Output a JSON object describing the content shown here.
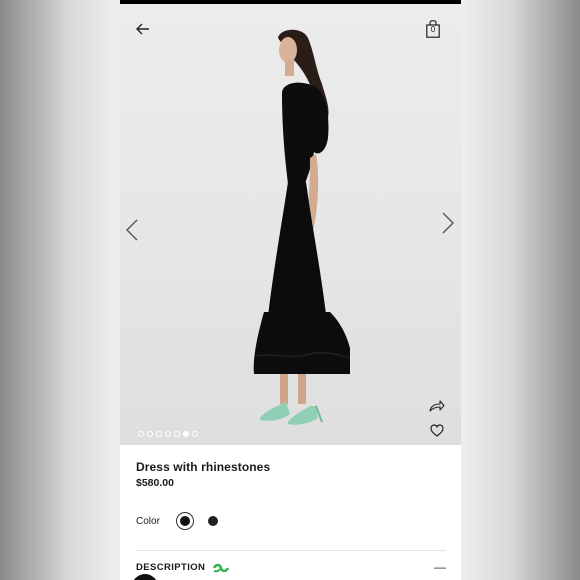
{
  "header": {
    "back_icon": "back-arrow-icon",
    "bag_icon": "shopping-bag-icon",
    "bag_count": "0"
  },
  "gallery": {
    "prev_icon": "chevron-left-icon",
    "next_icon": "chevron-right-icon",
    "share_icon": "share-icon",
    "wishlist_icon": "heart-icon",
    "total_images": 7,
    "active_index": 5
  },
  "product": {
    "title": "Dress with rhinestones",
    "price": "$580.00"
  },
  "color": {
    "label": "Color",
    "options": [
      {
        "name": "black",
        "hex": "#111111",
        "selected": true
      },
      {
        "name": "dark",
        "hex": "#222222",
        "selected": false
      }
    ]
  },
  "description": {
    "label": "DESCRIPTION",
    "eco_icon": "eco-leaf-icon",
    "eco_color": "#2bb34a",
    "toggle_icon": "minus-icon",
    "toggle_text": "—"
  }
}
